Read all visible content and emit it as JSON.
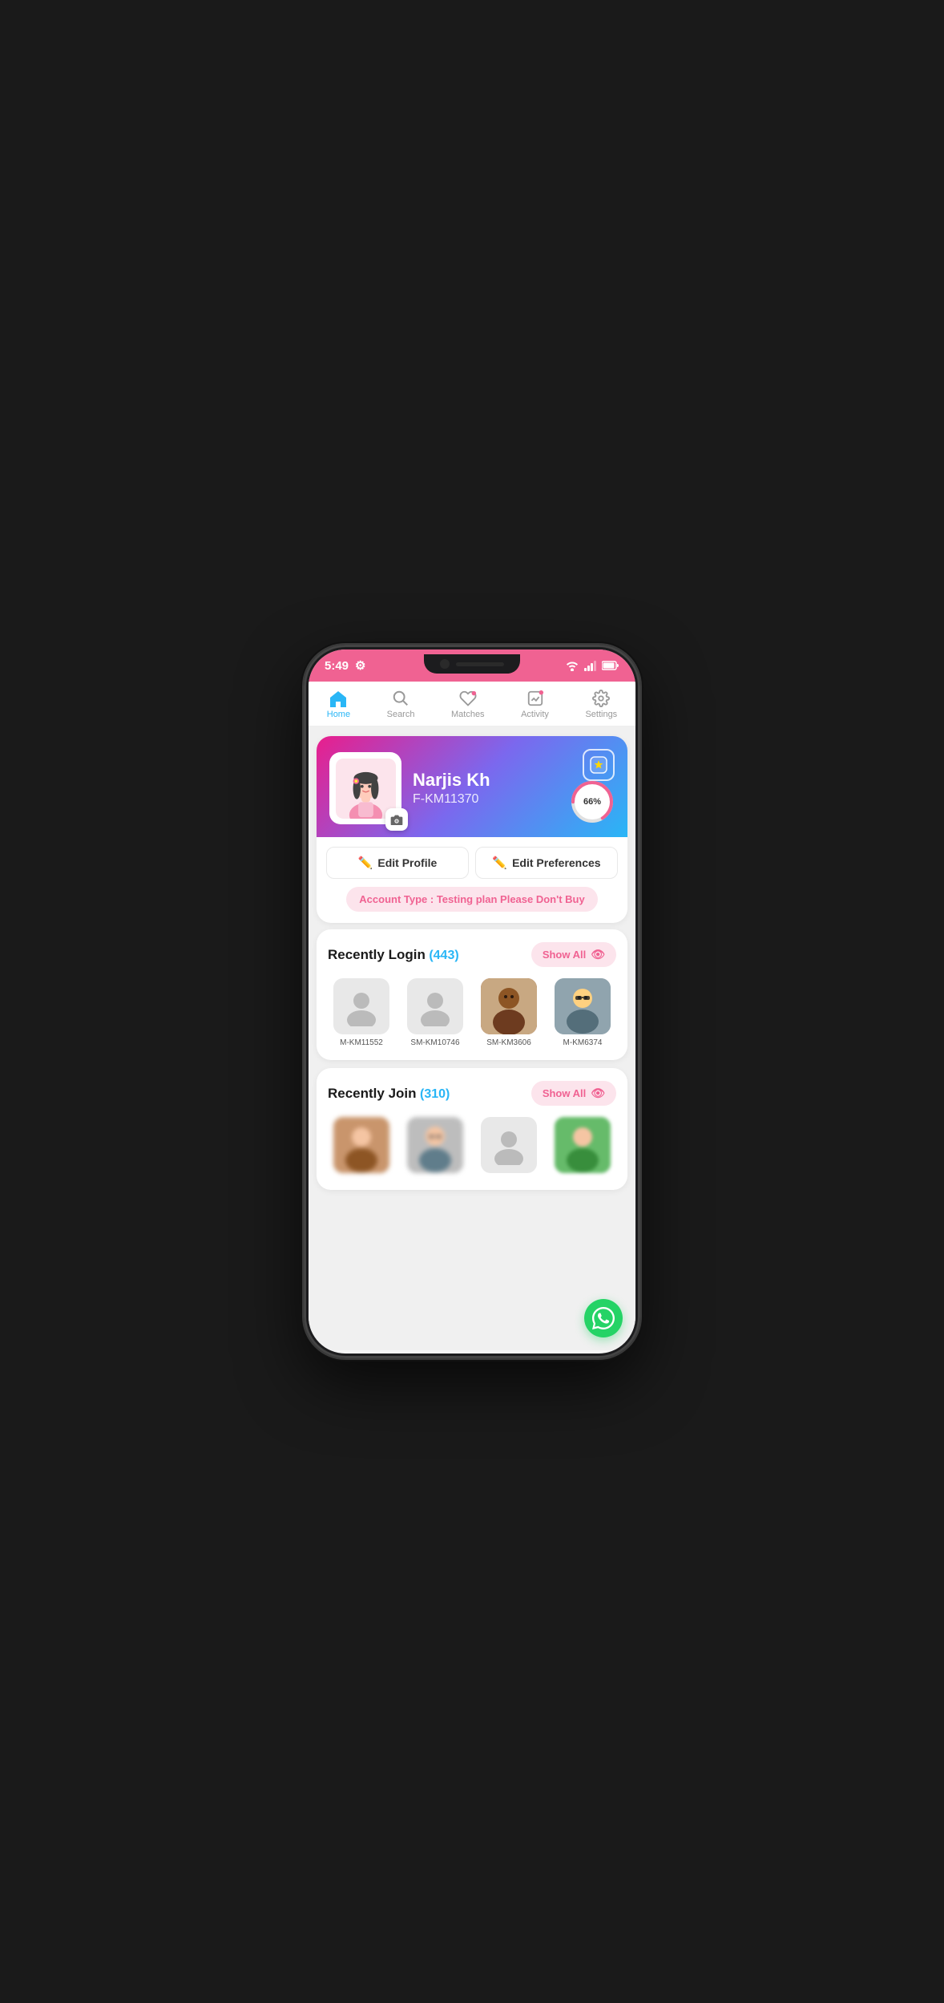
{
  "statusBar": {
    "time": "5:49",
    "settingsIcon": "⚙",
    "wifiIcon": "wifi",
    "signalIcon": "signal",
    "batteryIcon": "battery"
  },
  "nav": {
    "items": [
      {
        "id": "home",
        "label": "Home",
        "icon": "🏠",
        "active": true
      },
      {
        "id": "search",
        "label": "Search",
        "icon": "🔍",
        "active": false
      },
      {
        "id": "matches",
        "label": "Matches",
        "icon": "❤️",
        "active": false
      },
      {
        "id": "activity",
        "label": "Activity",
        "icon": "📊",
        "active": false
      },
      {
        "id": "settings",
        "label": "Settings",
        "icon": "⚙️",
        "active": false
      }
    ]
  },
  "profile": {
    "name": "Narjis Kh",
    "id": "F-KM11370",
    "progressPercent": "66%",
    "editProfileLabel": "Edit Profile",
    "editPreferencesLabel": "Edit Preferences",
    "accountTypeLabel": "Account Type : ",
    "accountTypePlan": "Testing plan Please Don't Buy"
  },
  "recentlyLogin": {
    "sectionTitle": "Recently Login",
    "count": "(443)",
    "showAllLabel": "Show All",
    "members": [
      {
        "id": "M-KM11552",
        "hasPhoto": false
      },
      {
        "id": "SM-KM10746",
        "hasPhoto": false
      },
      {
        "id": "SM-KM3606",
        "hasPhoto": true
      },
      {
        "id": "M-KM6374",
        "hasPhoto": true
      }
    ]
  },
  "recentlyJoin": {
    "sectionTitle": "Recently Join",
    "count": "(310)",
    "showAllLabel": "Show All",
    "members": [
      {
        "id": "rj1",
        "hasPhoto": true
      },
      {
        "id": "rj2",
        "hasPhoto": true
      },
      {
        "id": "rj3",
        "hasPhoto": false
      },
      {
        "id": "rj4",
        "hasPhoto": true
      }
    ]
  }
}
